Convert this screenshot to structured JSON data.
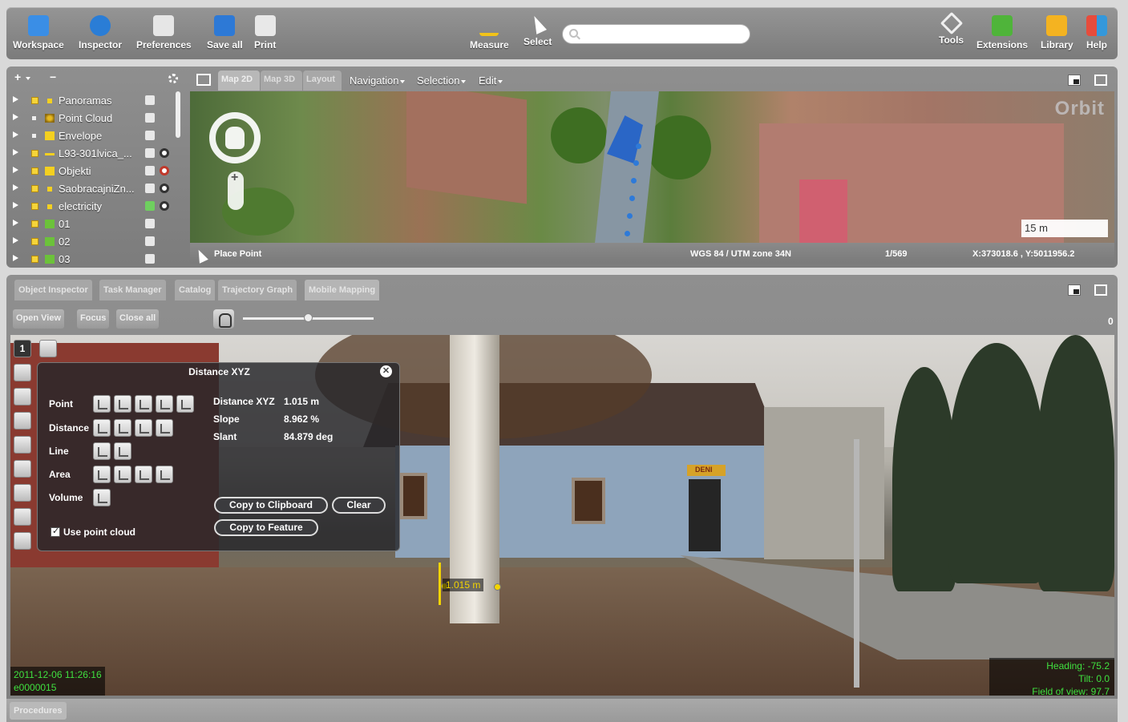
{
  "toolbar": {
    "buttons_left": [
      {
        "label": "Workspace",
        "icon": "workspace-icon",
        "color": "#3a8ee6"
      },
      {
        "label": "Inspector",
        "icon": "info-icon",
        "color": "#2a7dd6"
      },
      {
        "label": "Preferences",
        "icon": "preferences-icon",
        "color": "#e6e6e6"
      },
      {
        "label": "Save all",
        "icon": "save-icon",
        "color": "#2d79d6"
      },
      {
        "label": "Print",
        "icon": "printer-icon",
        "color": "#e8e8e8"
      }
    ],
    "buttons_mid": [
      {
        "label": "Measure",
        "icon": "measure-pencil-icon",
        "color": "#f2c319"
      },
      {
        "label": "Select",
        "icon": "arrow-cursor-icon",
        "color": "#ffffff"
      }
    ],
    "search_placeholder": "",
    "buttons_right": [
      {
        "label": "Tools",
        "icon": "tools-icon",
        "color": "#f0f0f0"
      },
      {
        "label": "Extensions",
        "icon": "puzzle-icon",
        "color": "#4fb43a"
      },
      {
        "label": "Library",
        "icon": "books-icon",
        "color": "#f4b321"
      },
      {
        "label": "Help",
        "icon": "help-tiles-icon",
        "color": "#e74c3c"
      }
    ]
  },
  "layers": {
    "add_label": "+",
    "remove_label": "−",
    "items": [
      {
        "name": "Panoramas",
        "visible": true
      },
      {
        "name": "Point Cloud",
        "visible": true
      },
      {
        "name": "Envelope",
        "visible": true
      },
      {
        "name": "L93-301lvica_...",
        "visible": true
      },
      {
        "name": "Objekti",
        "visible": true
      },
      {
        "name": "SaobracajniZn...",
        "visible": true
      },
      {
        "name": "electricity",
        "visible": true
      },
      {
        "name": "01",
        "visible": true
      },
      {
        "name": "02",
        "visible": true
      },
      {
        "name": "03",
        "visible": true
      }
    ]
  },
  "map_tabs": [
    "Map 2D",
    "Map 3D",
    "Layout"
  ],
  "map_menus": [
    "Navigation",
    "Selection",
    "Edit"
  ],
  "map": {
    "scale_label": "15 m",
    "logo_text": "Orbit"
  },
  "map_status": {
    "tool": "Place Point",
    "crs": "WGS 84 / UTM zone 34N",
    "scale": "1/569",
    "coords": "X:373018.6 , Y:5011956.2"
  },
  "lower_tabs": [
    "Object Inspector",
    "Task Manager",
    "Catalog",
    "Trajectory Graph",
    "Mobile Mapping"
  ],
  "lower_buttons": [
    "Open View",
    "Focus",
    "Close all"
  ],
  "frame_counter": "0",
  "slider_value": 0.5,
  "pano_tools": {
    "view_number": "1"
  },
  "dialog": {
    "title": "Distance XYZ",
    "rows": [
      "Point",
      "Distance",
      "Line",
      "Area",
      "Volume"
    ],
    "metrics": [
      {
        "label": "Distance XYZ",
        "value": "1.015 m"
      },
      {
        "label": "Slope",
        "value": "8.962 %"
      },
      {
        "label": "Slant",
        "value": "84.879 deg"
      }
    ],
    "copy_clipboard": "Copy to Clipboard",
    "clear": "Clear",
    "copy_feature": "Copy to Feature",
    "use_point_cloud": "Use point cloud",
    "use_point_cloud_checked": true
  },
  "measurement_label": "1.015 m",
  "pano_info": {
    "timestamp": "2011-12-06 11:26:16",
    "frame_id": "e0000015",
    "heading": "Heading: -75.2",
    "tilt": "Tilt: 0.0",
    "fov": "Field of view: 97.7"
  },
  "pano_sign": "DENI",
  "bottom_tab": "Procedures"
}
